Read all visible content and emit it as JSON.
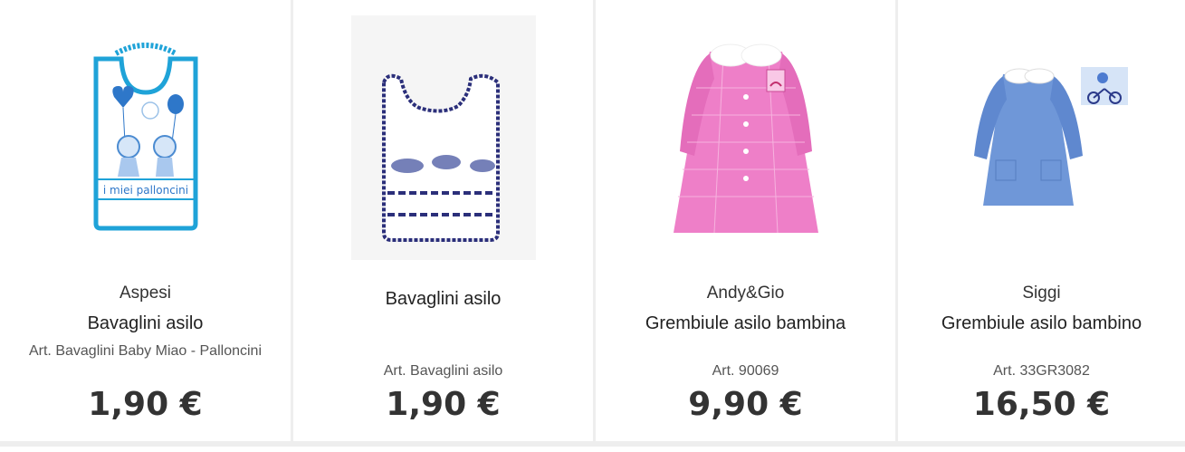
{
  "products": [
    {
      "brand": "Aspesi",
      "name": "Bavaglini asilo",
      "art": "Art. Bavaglini Baby Miao - Palloncini",
      "price": "1,90 €",
      "image_text": "i miei palloncini"
    },
    {
      "brand": "",
      "name": "Bavaglini asilo",
      "art": "Art. Bavaglini asilo",
      "price": "1,90 €"
    },
    {
      "brand": "Andy&Gio",
      "name": "Grembiule asilo bambina",
      "art": "Art. 90069",
      "price": "9,90 €"
    },
    {
      "brand": "Siggi",
      "name": "Grembiule asilo bambino",
      "art": "Art. 33GR3082",
      "price": "16,50 €"
    }
  ],
  "colors": {
    "bib1_trim": "#1fa3d8",
    "bib2_trim": "#2b2f7a",
    "pink_smock": "#ee7fc8",
    "blue_smock": "#6f97d8",
    "divider": "#eeeeee"
  }
}
